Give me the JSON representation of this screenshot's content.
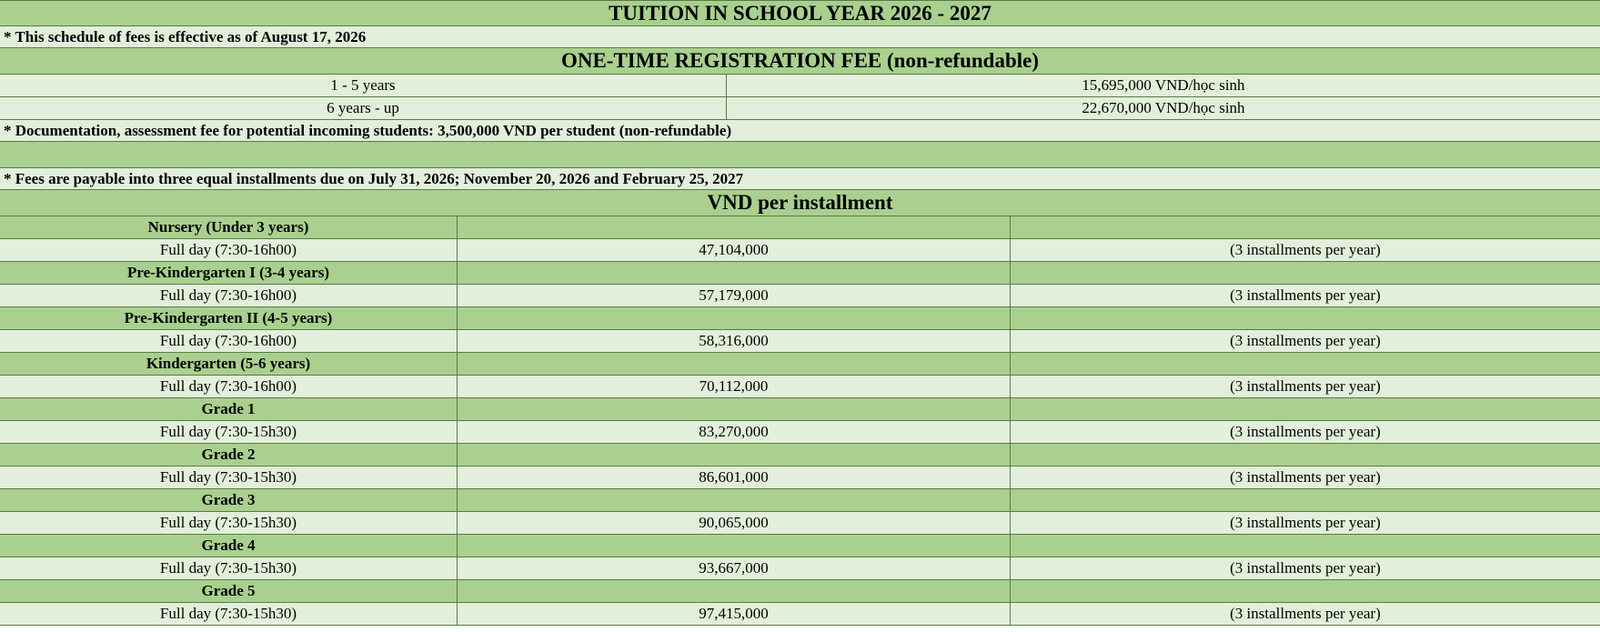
{
  "title": "TUITION IN SCHOOL YEAR 2026 - 2027",
  "effective_note": "* This schedule of fees is effective as of August 17, 2026",
  "registration": {
    "heading": "ONE-TIME REGISTRATION FEE (non-refundable)",
    "rows": [
      {
        "age": "1 - 5 years",
        "fee": "15,695,000 VND/học sinh"
      },
      {
        "age": "6 years - up",
        "fee": "22,670,000 VND/học sinh"
      }
    ]
  },
  "assessment_note": "* Documentation, assessment fee for potential incoming students: 3,500,000 VND per student (non-refundable)",
  "installment_note": "* Fees are payable into three equal installments due on July 31, 2026; November 20, 2026 and February 25, 2027",
  "installment_heading": "VND per installment",
  "tiers": [
    {
      "name": "Nursery (Under 3 years)",
      "schedule": "Full day (7:30-16h00)",
      "amount": "47,104,000",
      "note": "(3 installments per year)"
    },
    {
      "name": "Pre-Kindergarten I (3-4 years)",
      "schedule": "Full day (7:30-16h00)",
      "amount": "57,179,000",
      "note": "(3 installments per year)"
    },
    {
      "name": "Pre-Kindergarten II (4-5 years)",
      "schedule": "Full day (7:30-16h00)",
      "amount": "58,316,000",
      "note": "(3 installments per year)"
    },
    {
      "name": "Kindergarten (5-6 years)",
      "schedule": "Full day (7:30-16h00)",
      "amount": "70,112,000",
      "note": "(3 installments per year)"
    },
    {
      "name": "Grade 1",
      "schedule": "Full day (7:30-15h30)",
      "amount": "83,270,000",
      "note": "(3 installments per year)"
    },
    {
      "name": "Grade 2",
      "schedule": "Full day (7:30-15h30)",
      "amount": "86,601,000",
      "note": "(3 installments per year)"
    },
    {
      "name": "Grade 3",
      "schedule": "Full day (7:30-15h30)",
      "amount": "90,065,000",
      "note": "(3 installments per year)"
    },
    {
      "name": "Grade 4",
      "schedule": "Full day (7:30-15h30)",
      "amount": "93,667,000",
      "note": "(3 installments per year)"
    },
    {
      "name": "Grade 5",
      "schedule": "Full day (7:30-15h30)",
      "amount": "97,415,000",
      "note": "(3 installments per year)"
    }
  ],
  "colors": {
    "header_green": "#a9d08e",
    "row_light": "#e2efda",
    "grid": "#5a7a4a"
  }
}
